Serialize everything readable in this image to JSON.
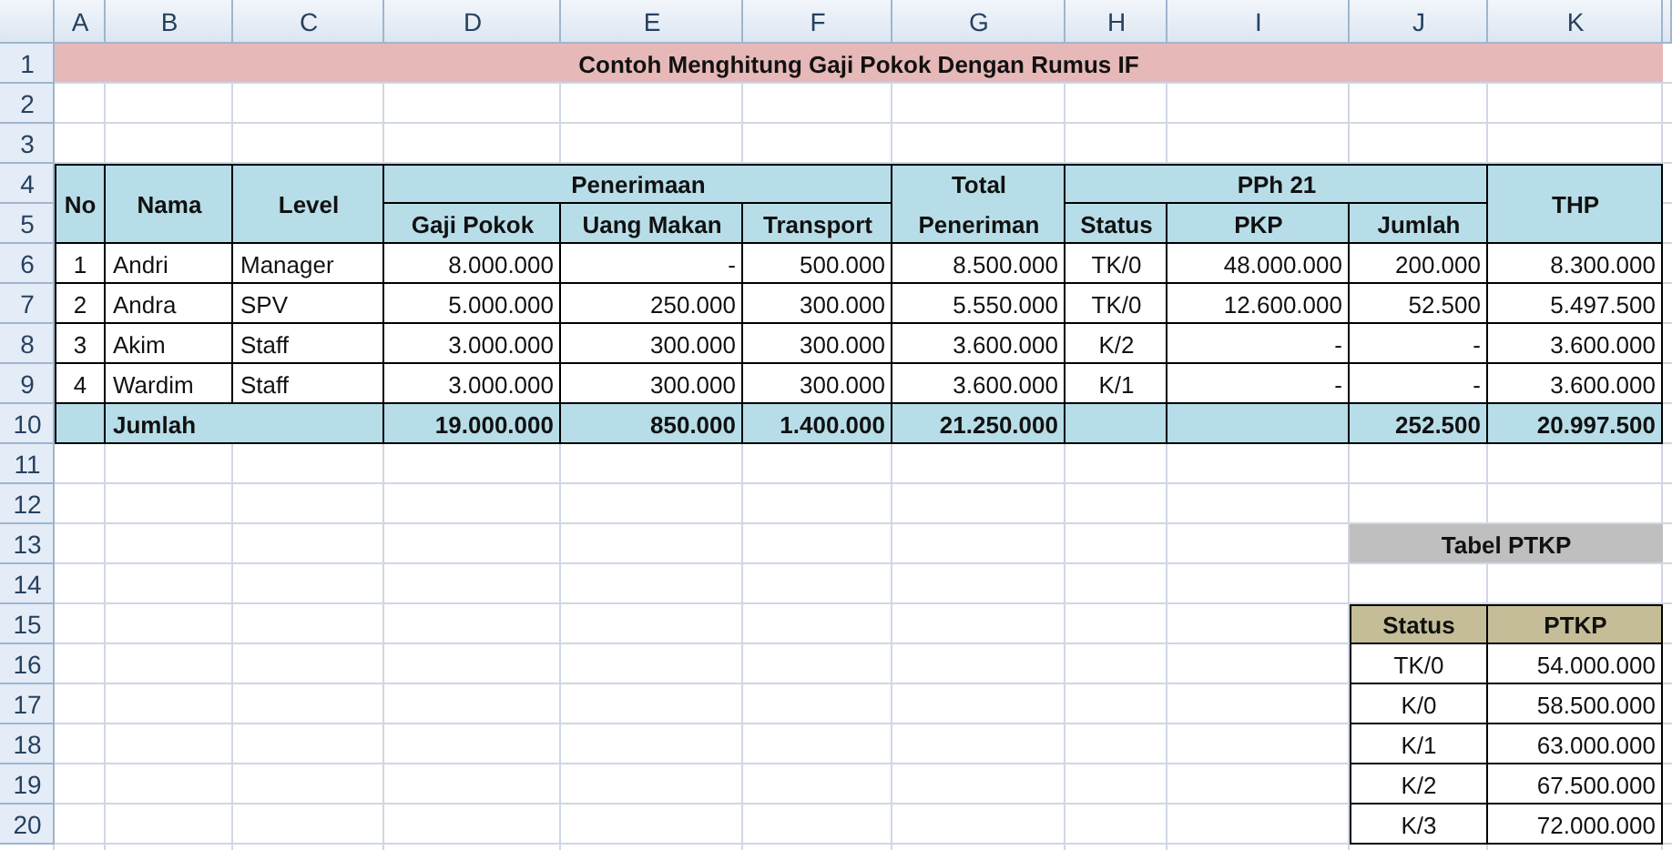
{
  "column_headers": [
    "A",
    "B",
    "C",
    "D",
    "E",
    "F",
    "G",
    "H",
    "I",
    "J",
    "K"
  ],
  "row_headers": [
    "1",
    "2",
    "3",
    "4",
    "5",
    "6",
    "7",
    "8",
    "9",
    "10",
    "11",
    "12",
    "13",
    "14",
    "15",
    "16",
    "17",
    "18",
    "19",
    "20"
  ],
  "title": "Contoh Menghitung Gaji Pokok Dengan Rumus IF",
  "main_table": {
    "group_headers": [
      "No",
      "Nama",
      "Level",
      "Penerimaan",
      "Total",
      "PPh 21",
      "THP"
    ],
    "sub_headers": [
      "Gaji Pokok",
      "Uang Makan",
      "Transport",
      "Peneriman",
      "Status",
      "PKP",
      "Jumlah"
    ],
    "rows": [
      [
        "1",
        "Andri",
        "Manager",
        "8.000.000",
        "-",
        "500.000",
        "8.500.000",
        "TK/0",
        "48.000.000",
        "200.000",
        "8.300.000"
      ],
      [
        "2",
        "Andra",
        "SPV",
        "5.000.000",
        "250.000",
        "300.000",
        "5.550.000",
        "TK/0",
        "12.600.000",
        "52.500",
        "5.497.500"
      ],
      [
        "3",
        "Akim",
        "Staff",
        "3.000.000",
        "300.000",
        "300.000",
        "3.600.000",
        "K/2",
        "-",
        "-",
        "3.600.000"
      ],
      [
        "4",
        "Wardim",
        "Staff",
        "3.000.000",
        "300.000",
        "300.000",
        "3.600.000",
        "K/1",
        "-",
        "-",
        "3.600.000"
      ]
    ],
    "total": {
      "label": "Jumlah",
      "cells": [
        {
          "kind": "value",
          "value": "19.000.000"
        },
        {
          "kind": "value",
          "value": "850.000"
        },
        {
          "kind": "value",
          "value": "1.400.000"
        },
        {
          "kind": "value",
          "value": "21.250.000"
        },
        {
          "kind": "blank"
        },
        {
          "kind": "blank"
        },
        {
          "kind": "value",
          "value": "252.500"
        },
        {
          "kind": "value",
          "value": "20.997.500"
        }
      ]
    }
  },
  "ptkp": {
    "title": "Tabel PTKP",
    "headers": [
      "Status",
      "PTKP"
    ],
    "rows": [
      [
        "TK/0",
        "54.000.000"
      ],
      [
        "K/0",
        "58.500.000"
      ],
      [
        "K/1",
        "63.000.000"
      ],
      [
        "K/2",
        "67.500.000"
      ],
      [
        "K/3",
        "72.000.000"
      ]
    ]
  }
}
